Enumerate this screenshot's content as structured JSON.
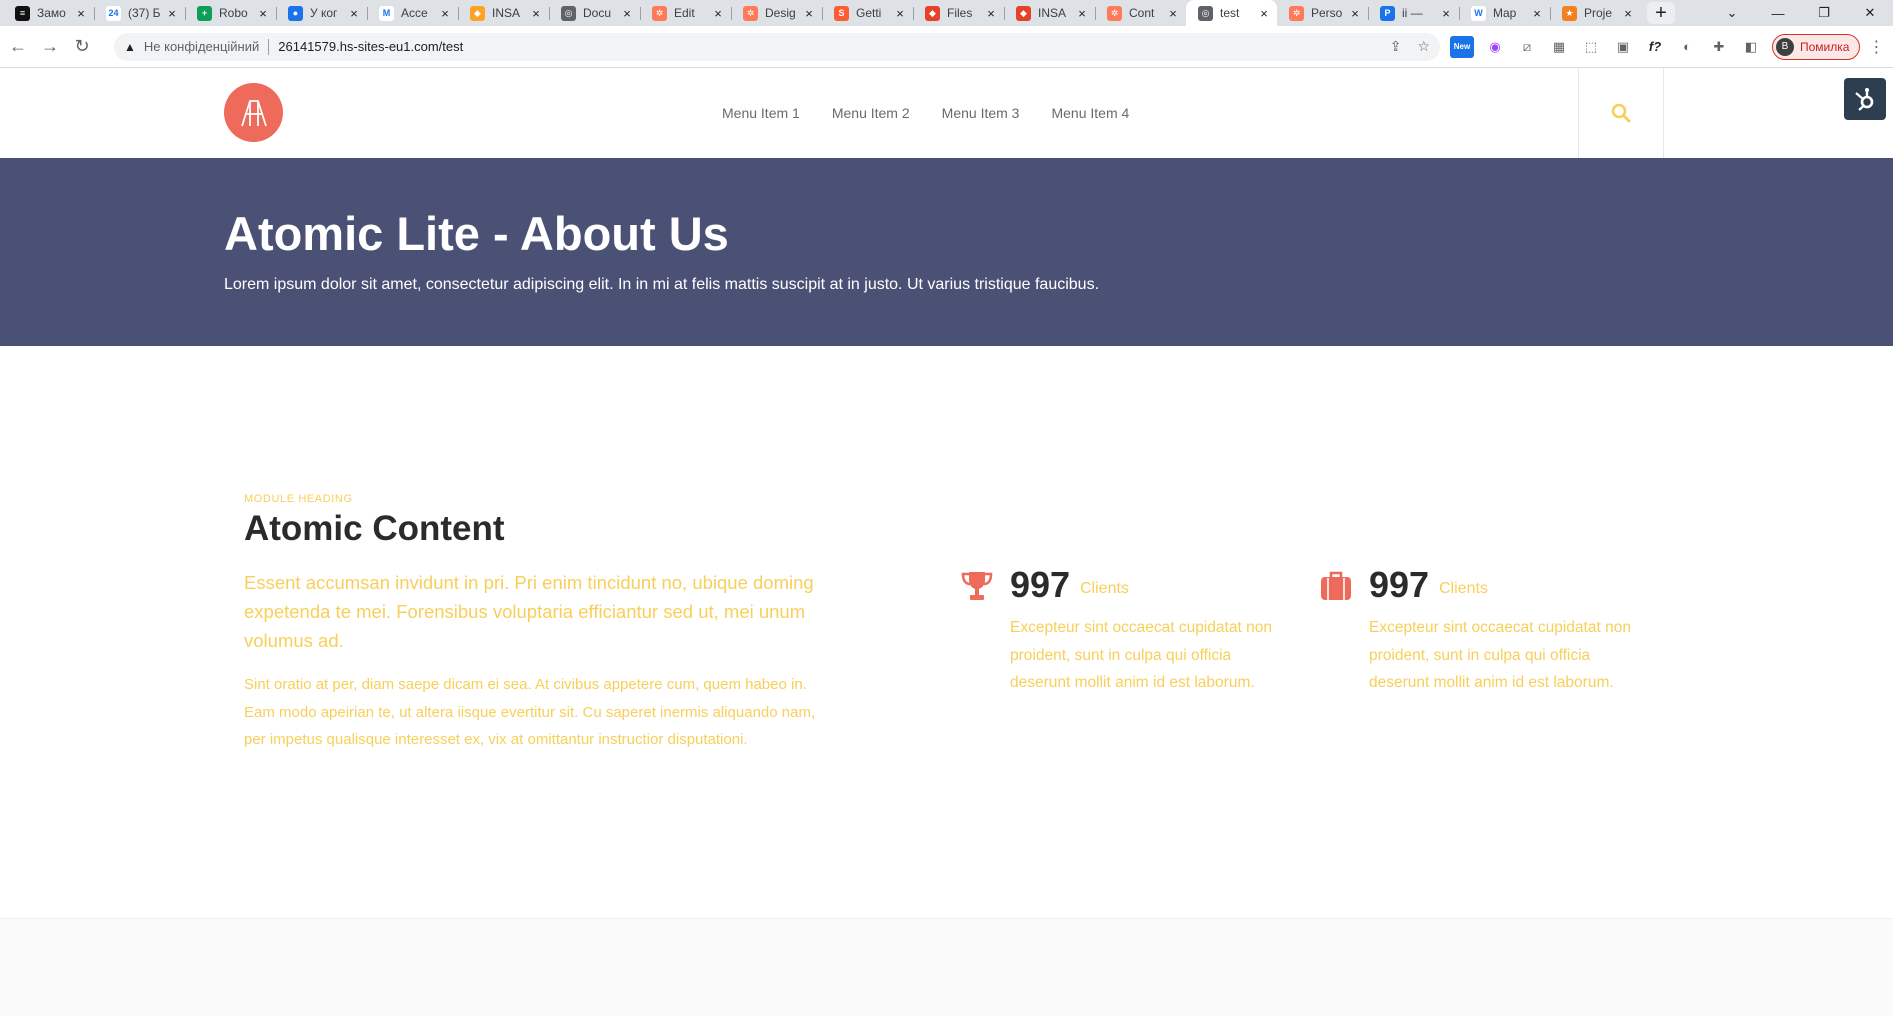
{
  "browser": {
    "tabs": [
      {
        "title": "Замо",
        "fav_bg": "#111111",
        "fav_txt": "≡"
      },
      {
        "title": "(37) Б",
        "fav_bg": "#ffffff",
        "fav_txt": "24"
      },
      {
        "title": "Robo",
        "fav_bg": "#0f9d58",
        "fav_txt": "+"
      },
      {
        "title": "У ког",
        "fav_bg": "#1a73e8",
        "fav_txt": "●"
      },
      {
        "title": "Acce",
        "fav_bg": "#ffffff",
        "fav_txt": "M"
      },
      {
        "title": "INSA",
        "fav_bg": "#fca326",
        "fav_txt": "◆"
      },
      {
        "title": "Docu",
        "fav_bg": "#5f6368",
        "fav_txt": "◎"
      },
      {
        "title": "Edit",
        "fav_bg": "#ff7a59",
        "fav_txt": "✲"
      },
      {
        "title": "Desig",
        "fav_bg": "#ff7a59",
        "fav_txt": "✲"
      },
      {
        "title": "Getti",
        "fav_bg": "#ff5c35",
        "fav_txt": "S"
      },
      {
        "title": "Files",
        "fav_bg": "#e24329",
        "fav_txt": "◆"
      },
      {
        "title": "INSA",
        "fav_bg": "#e24329",
        "fav_txt": "◆"
      },
      {
        "title": "Cont",
        "fav_bg": "#ff7a59",
        "fav_txt": "✲"
      },
      {
        "title": "test",
        "fav_bg": "#5f6368",
        "fav_txt": "◎"
      },
      {
        "title": "Perso",
        "fav_bg": "#ff7a59",
        "fav_txt": "✲"
      },
      {
        "title": "ii —",
        "fav_bg": "#1a73e8",
        "fav_txt": "P"
      },
      {
        "title": "Map",
        "fav_bg": "#ffffff",
        "fav_txt": "W"
      },
      {
        "title": "Proje",
        "fav_bg": "#f38020",
        "fav_txt": "★"
      }
    ],
    "active_tab": 13,
    "new_tab_symbol": "+",
    "window_controls": [
      "⌄",
      "—",
      "❐",
      "✕"
    ],
    "security_label": "Не конфіденційний",
    "url": "26141579.hs-sites-eu1.com/test",
    "new_badge": "New",
    "profile_initial": "B",
    "profile_label": "Помилка"
  },
  "site": {
    "brand_color": "#ee6a5a",
    "accent_color": "#f8cf5a",
    "hero_color": "#4a5175",
    "menu": [
      "Menu Item 1",
      "Menu Item 2",
      "Menu Item 3",
      "Menu Item 4"
    ],
    "hero": {
      "title": "Atomic Lite - About Us",
      "subtitle": "Lorem ipsum dolor sit amet, consectetur adipiscing elit. In in mi at felis mattis suscipit at in justo. Ut varius tristique faucibus."
    },
    "content": {
      "eyebrow": "MODULE HEADING",
      "heading": "Atomic Content",
      "lead": "Essent accumsan invidunt in pri. Pri enim tincidunt no, ubique doming expetenda te mei. Forensibus voluptaria efficiantur sed ut, mei unum volumus ad.",
      "body": "Sint oratio at per, diam saepe dicam ei sea. At civibus appetere cum, quem habeo in. Eam modo apeirian te, ut altera iisque evertitur sit. Cu saperet inermis aliquando nam, per impetus qualisque interesset ex, vix at omittantur instructior disputationi."
    },
    "stats": [
      {
        "icon": "trophy-icon",
        "number": "997",
        "unit": "Clients",
        "desc": "Excepteur sint occaecat cupidatat non proident, sunt in culpa qui officia deserunt mollit anim id est laborum."
      },
      {
        "icon": "briefcase-icon",
        "number": "997",
        "unit": "Clients",
        "desc": "Excepteur sint occaecat cupidatat non proident, sunt in culpa qui officia deserunt mollit anim id est laborum."
      }
    ]
  }
}
